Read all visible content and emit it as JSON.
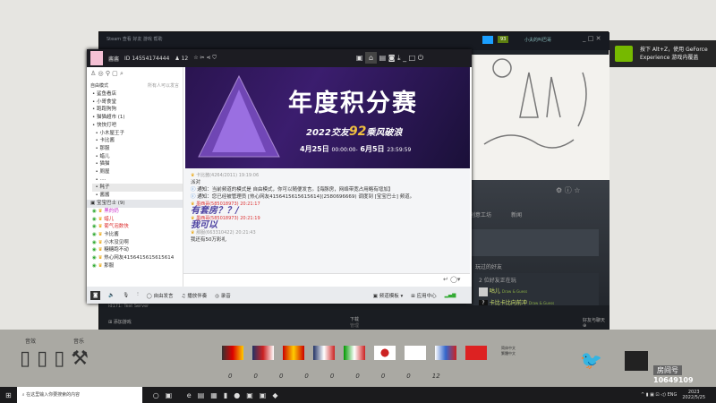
{
  "steam": {
    "menu": "Steam  查看  好友  游戏  帮助",
    "user": "小夫的叫巴哥",
    "notif_count": "93",
    "tabs": [
      "创意工坊",
      "新闻"
    ],
    "friends_header": "玩过的好友",
    "playing": "2 位好友正在玩",
    "friends": [
      {
        "name": "咕儿",
        "game": "Draw & Guess"
      },
      {
        "name": "卡比卡比向前冲",
        "game": "Draw & Guess"
      }
    ],
    "server": "id171: Test Server",
    "add_game": "添加游戏",
    "download": "下载",
    "download_sub": "管理",
    "friends_chat": "好友与聊天"
  },
  "yy": {
    "name": "酱酱",
    "id": "ID 14554174444",
    "members": "12",
    "mode": "自由模式",
    "mode_right": "所有人可以发言",
    "tree": [
      "鲨鱼看店",
      "小哥食堂",
      "跑跑狗狗",
      "猫猫超市 (1)",
      "快快打吧",
      "小木屋王子",
      "卡比酱",
      "那服",
      "蜡儿",
      "猫猫",
      "厕屋",
      "····",
      "耗子",
      "酱酱"
    ],
    "group": "宝宝巴士 (9)",
    "members_list": [
      "黑的奶",
      "蜡儿",
      "葡气泡数快",
      "卡比酱",
      "小木没见啊",
      "糖糖跑不动",
      "热心网友4156415615615614",
      "那服"
    ],
    "banner": {
      "title": "年度积分赛",
      "sub": "2022交友",
      "badge": "92",
      "sub2": "乘风破浪",
      "date1": "4月25日",
      "time1": "00:00:00-",
      "date2": "6月5日",
      "time2": "23:59:59"
    },
    "messages": [
      {
        "head": "卡比酱(4264/2011) 19:19:06",
        "text": "派对",
        "type": "normal"
      },
      {
        "head": "",
        "text": "通知：当前频道的模式是 自由模式，你可以随便发言。【海豚房，网络带宽占用略有增加】",
        "type": "notice"
      },
      {
        "head": "",
        "text": "通知：您已经被管理员 [热心网友415641561561561​4](2580696669) 调度到 [宝宝巴士] 频道。",
        "type": "notice"
      },
      {
        "head": "墨西哥(585018973) 20:21:17",
        "text": "有套房？？/",
        "type": "hand"
      },
      {
        "head": "墨西哥(585018973) 20:21:19",
        "text": "我可以",
        "type": "hand"
      },
      {
        "head": "那服(663310422) 20:21:43",
        "text": "我还有50万彩礼",
        "type": "normal"
      }
    ],
    "toolbar": {
      "free": "自由发言",
      "music": "播放伴奏",
      "record": "录音",
      "template": "频道模板",
      "apps": "应用中心"
    }
  },
  "overlay": {
    "sound": "音效",
    "music": "音乐",
    "counts": [
      "0",
      "0",
      "0",
      "0",
      "0",
      "0",
      "0",
      "0",
      "12"
    ],
    "lang1": "简体中文",
    "lang2": "繁體中文",
    "room_label": "房间号",
    "room": "10649109"
  },
  "nvidia": {
    "line1": "按下 Alt+Z，使用 GeForce",
    "line2": "Experience 游戏内覆盖"
  },
  "taskbar": {
    "search": "在这里输入你要搜索的内容",
    "lang": "ENG",
    "year": "2023",
    "date": "2022/5/25"
  }
}
